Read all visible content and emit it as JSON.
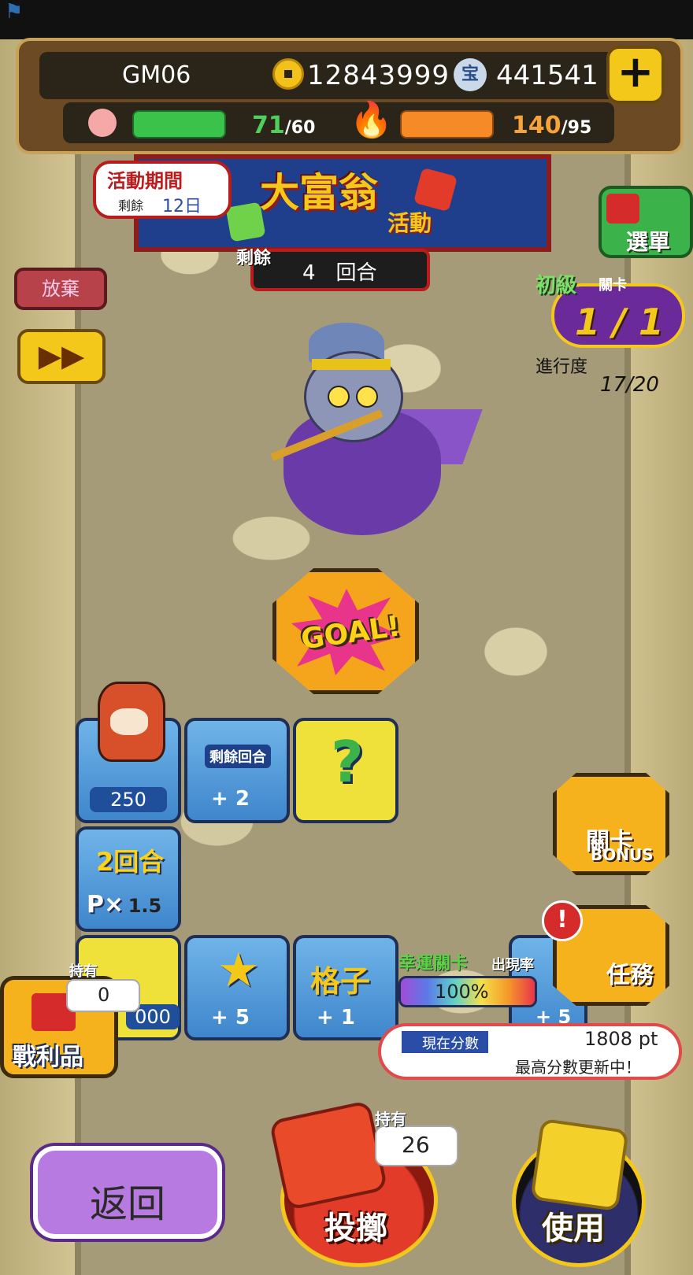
{
  "header": {
    "player_name": "GM06",
    "coins": "12843999",
    "gems": "441541",
    "gem_icon_glyph": "宝",
    "add_currency_glyph": "+",
    "stamina": {
      "current": "71",
      "max": "/60",
      "fill_fraction": 1.0
    },
    "energy": {
      "current": "140",
      "max": "/95",
      "fill_fraction": 1.0
    }
  },
  "event": {
    "title": "大富翁",
    "subtitle": "活動",
    "period_label": "活動期間",
    "remaining_label": "剩餘",
    "remaining_days": "12日",
    "turns_label": "剩餘",
    "turns_value": "4　回合"
  },
  "left_controls": {
    "quit_label": "放棄",
    "fast_forward_glyph": "▶▶"
  },
  "right_panel": {
    "menu_label": "選單",
    "stage_level": "初級",
    "stage_label": "關卡",
    "stage_value": "1 / 1",
    "progress_label": "進行度",
    "progress_value": "17/20"
  },
  "board": {
    "goal_label": "GOAL!",
    "tiles": [
      {
        "name": "start",
        "value": "250"
      },
      {
        "name": "extra-turns",
        "title": "剩餘回合",
        "value": "+ 2"
      },
      {
        "name": "mystery",
        "glyph": "?"
      },
      {
        "name": "multiplier",
        "title": "2回合",
        "value": "1.5",
        "prefix": "P×"
      },
      {
        "name": "points",
        "value": "000"
      },
      {
        "name": "star",
        "value": "+ 5"
      },
      {
        "name": "grid",
        "title": "格子",
        "value": "+ 1"
      },
      {
        "name": "partial",
        "value": "+ 5"
      }
    ]
  },
  "bonus": {
    "title": "關卡",
    "sub": "BONUS"
  },
  "mission": {
    "label": "任務",
    "alert_glyph": "!"
  },
  "lucky_stage": {
    "title": "幸運關卡",
    "rate_label": "出現率",
    "rate_value": "100%"
  },
  "score": {
    "label": "現在分數",
    "value": "1808 pt",
    "note": "最高分數更新中！"
  },
  "loot": {
    "label": "戰利品",
    "owned_label": "持有",
    "owned_value": "0"
  },
  "bottom": {
    "back_label": "返回",
    "throw_label": "投擲",
    "dice_owned_label": "持有",
    "dice_owned_value": "26",
    "use_label": "使用"
  },
  "colors": {
    "hp_bar": "#3ac24a",
    "energy_bar": "#f58a26",
    "banner_bg": "#1f3f8c",
    "accent_gold": "#f4c81b",
    "score_border": "#e04a4a"
  }
}
